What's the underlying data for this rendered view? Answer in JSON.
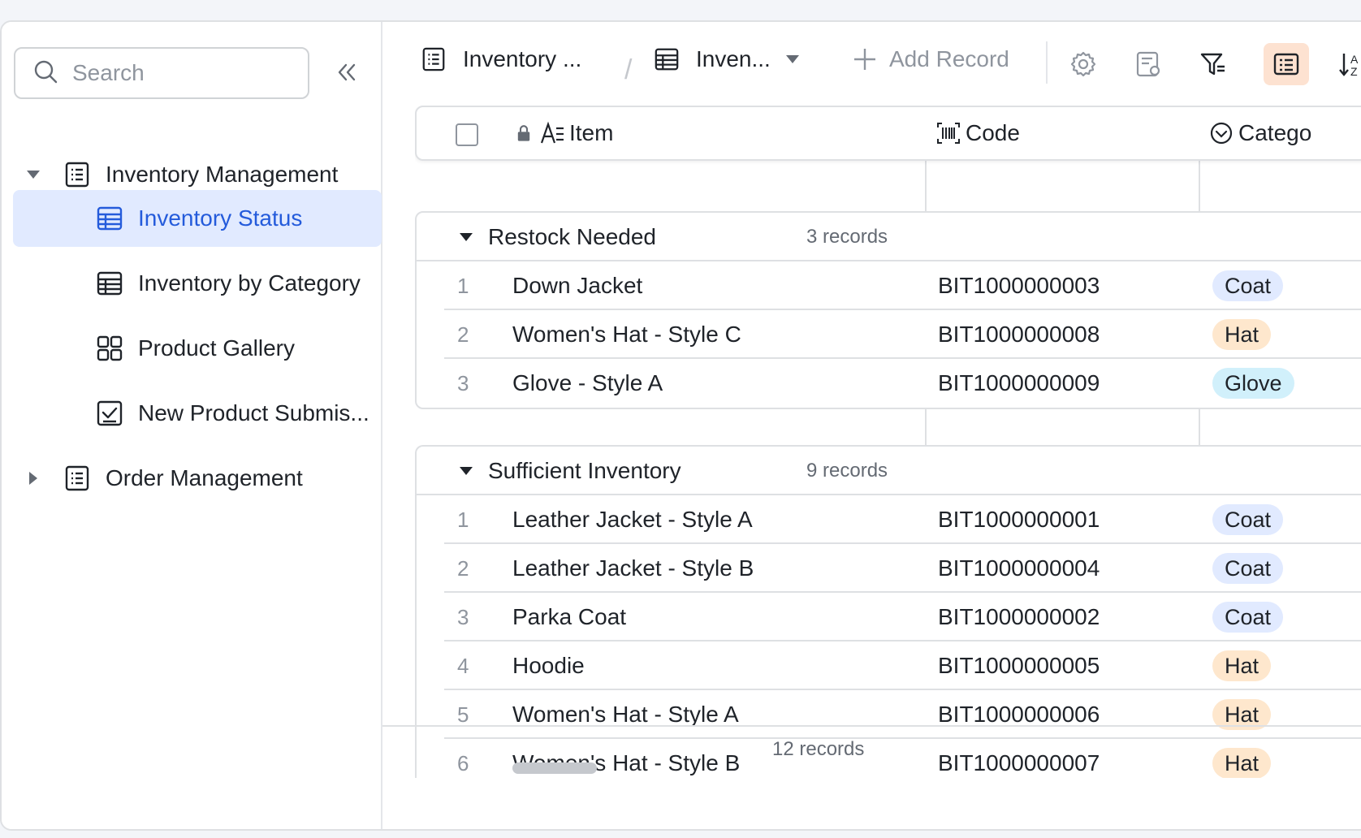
{
  "sidebar": {
    "search_placeholder": "Search",
    "items": [
      {
        "label": "Inventory Management",
        "icon": "document-list-icon"
      },
      {
        "label": "Inventory Status",
        "icon": "table-icon"
      },
      {
        "label": "Inventory by Category",
        "icon": "table-icon"
      },
      {
        "label": "Product Gallery",
        "icon": "gallery-icon"
      },
      {
        "label": "New Product Submis...",
        "icon": "form-check-icon"
      },
      {
        "label": "Order Management",
        "icon": "document-list-icon"
      }
    ]
  },
  "toolbar": {
    "table_name": "Inventory ...",
    "separator": "/",
    "view_name": "Inven...",
    "add_record_label": "Add Record"
  },
  "table": {
    "columns": [
      "Item",
      "Code",
      "Catego"
    ],
    "groups": [
      {
        "title": "Restock Needed",
        "count": "3 records",
        "rows": [
          {
            "n": "1",
            "item": "Down Jacket",
            "code": "BIT1000000003",
            "category": "Coat"
          },
          {
            "n": "2",
            "item": "Women's Hat - Style C",
            "code": "BIT1000000008",
            "category": "Hat"
          },
          {
            "n": "3",
            "item": "Glove - Style A",
            "code": "BIT1000000009",
            "category": "Glove"
          }
        ]
      },
      {
        "title": "Sufficient Inventory",
        "count": "9 records",
        "rows": [
          {
            "n": "1",
            "item": "Leather Jacket - Style A",
            "code": "BIT1000000001",
            "category": "Coat"
          },
          {
            "n": "2",
            "item": "Leather Jacket - Style B",
            "code": "BIT1000000004",
            "category": "Coat"
          },
          {
            "n": "3",
            "item": "Parka Coat",
            "code": "BIT1000000002",
            "category": "Coat"
          },
          {
            "n": "4",
            "item": "Hoodie",
            "code": "BIT1000000005",
            "category": "Hat"
          },
          {
            "n": "5",
            "item": "Women's Hat - Style A",
            "code": "BIT1000000006",
            "category": "Hat"
          },
          {
            "n": "6",
            "item": "Women's Hat - Style B",
            "code": "BIT1000000007",
            "category": "Hat"
          }
        ]
      }
    ],
    "total": "12 records"
  },
  "tag_colors": {
    "Coat": {
      "bg": "#e1eaff",
      "fg": "#1f2329"
    },
    "Hat": {
      "bg": "#fee7cd",
      "fg": "#1f2329"
    },
    "Glove": {
      "bg": "#d1f0fb",
      "fg": "#1f2329"
    }
  },
  "colors": {
    "accent": "#245bdb",
    "active_bg": "#e1eaff",
    "toolbar_active_bg": "#fde2d1"
  }
}
